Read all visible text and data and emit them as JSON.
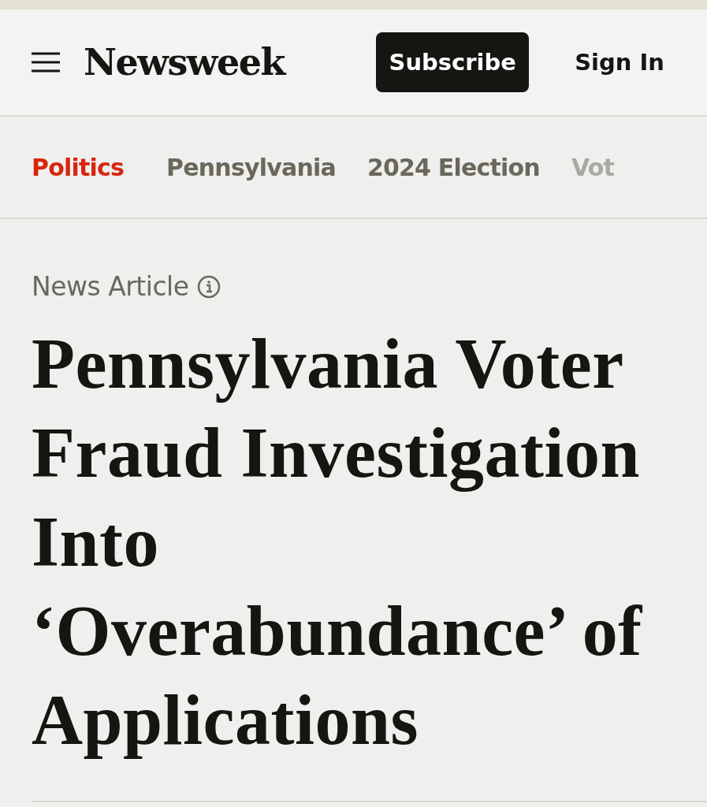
{
  "header": {
    "logo": "Newsweek",
    "subscribe": "Subscribe",
    "sign_in": "Sign In"
  },
  "topics": [
    {
      "label": "Politics",
      "selected": true
    },
    {
      "label": "Pennsylvania",
      "selected": false
    },
    {
      "label": "2024 Election",
      "selected": false
    },
    {
      "label": "Vot",
      "selected": false
    }
  ],
  "article": {
    "type_label": "News Article",
    "headline": "Pennsylvania Voter Fraud Investigation Into ‘Overabundance’ of Applications"
  }
}
